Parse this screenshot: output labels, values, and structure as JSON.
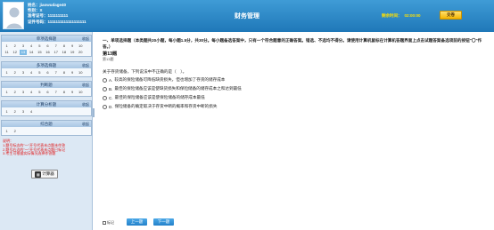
{
  "header": {
    "name_label": "姓名：",
    "name_value": "jiaowudage40",
    "gender_label": "性别：",
    "gender_value": "X",
    "id_label": "准考证号：",
    "id_value": "1111111111",
    "cert_label": "证件号码：",
    "cert_value": "1111111111111111111",
    "title": "财务管理",
    "timer_label": "剩余时间：",
    "timer_value": "02:00:00",
    "submit_label": "交卷",
    "colors": {
      "header_top": "#3f9cd6",
      "header_bottom": "#1f78b8",
      "timer": "#ffe000",
      "submit": "#f4b400"
    }
  },
  "sidebar": {
    "panel1": {
      "title": "单项选择题",
      "toggle": "收起",
      "numbers": [
        "1",
        "2",
        "3",
        "4",
        "5",
        "6",
        "7",
        "8",
        "9",
        "10",
        "11",
        "12",
        "13",
        "14",
        "15",
        "16",
        "17",
        "18",
        "19",
        "20"
      ],
      "current": "13"
    },
    "panel2": {
      "title": "多项选择题",
      "toggle": "收起",
      "numbers": [
        "1",
        "2",
        "3",
        "4",
        "5",
        "6",
        "7",
        "8",
        "9",
        "10"
      ]
    },
    "panel3": {
      "title": "判断题",
      "toggle": "收起",
      "numbers": [
        "1",
        "2",
        "3",
        "4",
        "5",
        "6",
        "7",
        "8",
        "9",
        "10"
      ]
    },
    "panel4": {
      "title": "计算分析题",
      "toggle": "收起",
      "numbers": [
        "1",
        "2",
        "3",
        "4"
      ]
    },
    "panel5": {
      "title": "综合题",
      "toggle": "收起",
      "numbers": [
        "1",
        "2"
      ]
    },
    "note": [
      "说明：",
      "1.题号标志的\"一\"开号代表未点题未作答",
      "2.题号右边的\"一\"开号代表未点题已标记",
      "3.考生可根据实际情况选择作答题"
    ],
    "calc_label": "计算器",
    "calc_icon": "calculator-icon"
  },
  "main": {
    "instructions": "一、单项选择题（本类题共20小题，每小题1.5分，共30分。每小题备选答案中，只有一个符合题意的正确答案。错选、不选均不得分。请使用计算机鼠标在计算机答题界面上点击试题答案备选项前的按钮\"〇\"作答。）",
    "question_title": "第13题",
    "question_sub": "第13题",
    "stem": "关于存货储备，下列说法中不正确的是（　）。",
    "options": [
      {
        "letter": "A.",
        "text": "较高的保险储备可降低缺货损失，但也增加了存货的储存成本"
      },
      {
        "letter": "B.",
        "text": "最佳的保险储备应该是使缺货损失和保险储备的储存成本之和达到最低"
      },
      {
        "letter": "C.",
        "text": "最佳的保险储备应该是使保险储备的储存成本最低"
      },
      {
        "letter": "D.",
        "text": "保险储备的确定取决于存货中断的概率和存货中断的损失"
      }
    ],
    "mark_label": "标记",
    "prev_label": "上一题",
    "next_label": "下一题"
  }
}
